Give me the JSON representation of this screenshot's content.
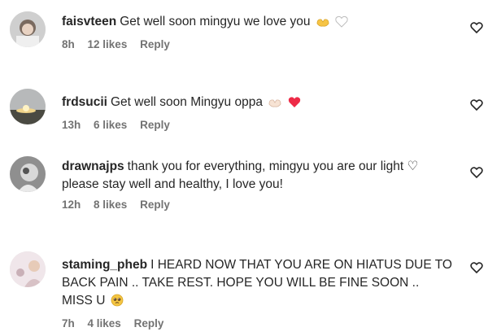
{
  "comments": [
    {
      "username": "faisvteen",
      "text": "Get well soon mingyu we love you",
      "time": "8h",
      "likes": "12 likes",
      "reply": "Reply",
      "emojis": [
        "heart-hands-emoji",
        "white-heart-emoji"
      ]
    },
    {
      "username": "frdsucii",
      "text": "Get well soon Mingyu oppa",
      "time": "13h",
      "likes": "6 likes",
      "reply": "Reply",
      "emojis": [
        "heart-hands-emoji",
        "red-heart-emoji"
      ]
    },
    {
      "username": "drawnajps",
      "text": "thank you for everything, mingyu you are our light ♡ please stay well and healthy, I love you!",
      "time": "12h",
      "likes": "8 likes",
      "reply": "Reply",
      "emojis": []
    },
    {
      "username": "staming_pheb",
      "text": "I HEARD NOW THAT YOU ARE ON HIATUS DUE TO BACK PAIN .. TAKE REST. HOPE YOU WILL BE FINE SOON .. MISS U",
      "time": "7h",
      "likes": "4 likes",
      "reply": "Reply",
      "emojis": [
        "pleading-face-emoji"
      ]
    }
  ],
  "colors": {
    "text": "#262626",
    "meta": "#737373",
    "red_heart": "#ed2a46",
    "pleading_face": "#f4c542"
  },
  "icons": {
    "like": "heart-outline-icon"
  }
}
